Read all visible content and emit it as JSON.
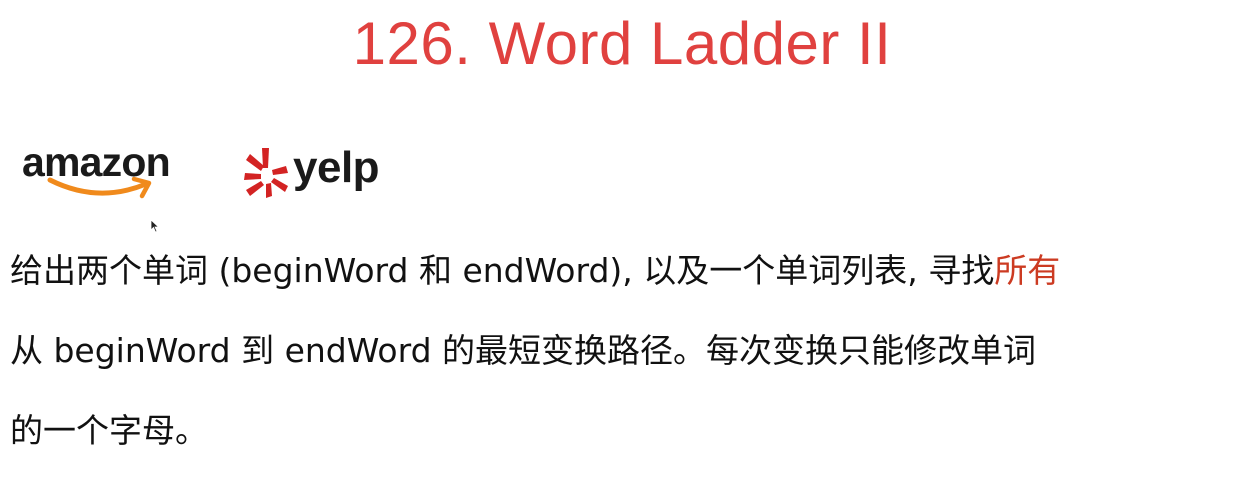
{
  "slide": {
    "title": "126. Word Ladder II",
    "logos": {
      "amazon": "amazon",
      "yelp": "yelp"
    },
    "description": {
      "line1_pre": "给出两个单词 (beginWord 和 endWord), 以及一个单词列表, 寻找",
      "line1_highlight": "所有",
      "line2": "从 beginWord 到 endWord 的最短变换路径。每次变换只能修改单词",
      "line3": "的一个字母。"
    }
  },
  "colors": {
    "title": "#e0413f",
    "highlight": "#cc3b22",
    "amazon_smile": "#f08a1c",
    "yelp_burst": "#d32323",
    "text": "#111111"
  }
}
